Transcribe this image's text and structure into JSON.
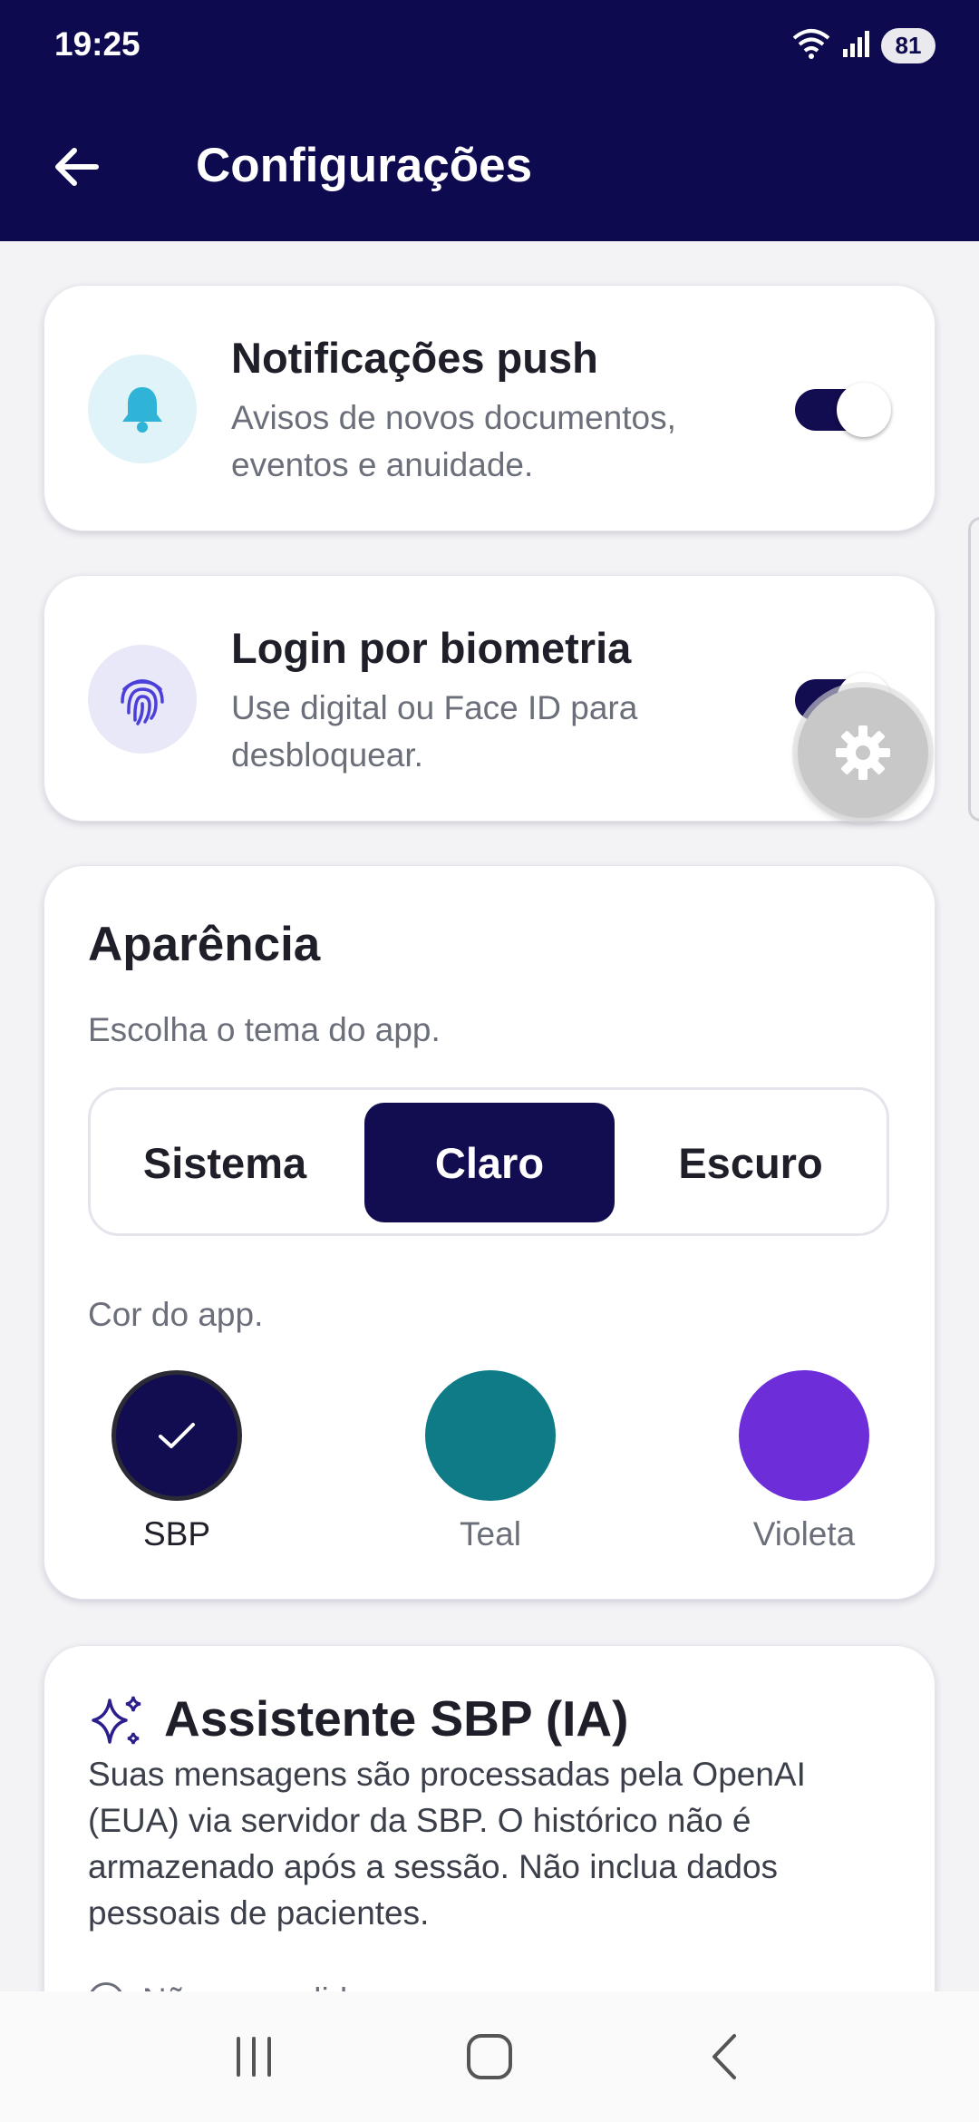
{
  "status_bar": {
    "time": "19:25",
    "battery": "81",
    "icons": [
      "wifi-icon",
      "signal-icon",
      "battery-icon"
    ]
  },
  "header": {
    "title": "Configurações",
    "back_icon": "arrow-left-icon",
    "background_color": "#0e0a4f"
  },
  "settings": {
    "push": {
      "title": "Notificações push",
      "subtitle": "Avisos de novos documentos, eventos e anuidade.",
      "icon": "bell-icon",
      "enabled": true
    },
    "biometric": {
      "title": "Login por biometria",
      "subtitle": "Use digital ou Face ID para desbloquear.",
      "icon": "fingerprint-icon",
      "enabled": true
    }
  },
  "appearance": {
    "title": "Aparência",
    "theme_hint": "Escolha o tema do app.",
    "themes": [
      "Sistema",
      "Claro",
      "Escuro"
    ],
    "selected_theme": "Claro",
    "color_hint": "Cor do app.",
    "colors": [
      {
        "label": "SBP",
        "hex": "#120c50",
        "selected": true
      },
      {
        "label": "Teal",
        "hex": "#0f7b86",
        "selected": false
      },
      {
        "label": "Violeta",
        "hex": "#6d2ed9",
        "selected": false
      }
    ]
  },
  "assistant": {
    "title": "Assistente SBP (IA)",
    "icon": "sparkles-icon",
    "description": "Suas mensagens são processadas pela OpenAI (EUA) via servidor da SBP. O histórico não é armazenado após a sessão. Não inclua dados pessoais de pacientes.",
    "consent_label": "Não concedido"
  },
  "floating_button": {
    "icon": "gear-icon"
  },
  "navbar": {
    "icons": [
      "recent-apps-icon",
      "home-icon",
      "back-icon"
    ]
  },
  "accent_color": "#120c50"
}
